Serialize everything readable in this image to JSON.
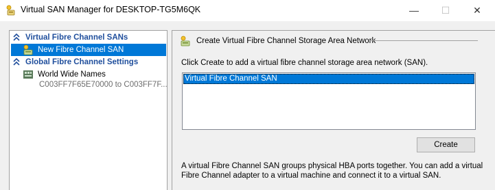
{
  "window": {
    "title": "Virtual SAN Manager for DESKTOP-TG5M6QK",
    "minimize_glyph": "—",
    "maximize_glyph": "☐",
    "close_glyph": "✕"
  },
  "sidebar": {
    "groups": [
      {
        "label": "Virtual Fibre Channel SANs",
        "icon": "chevron-up-icon",
        "items": [
          {
            "label": "New Fibre Channel SAN",
            "icon": "new-san-icon",
            "selected": true
          }
        ]
      },
      {
        "label": "Global Fibre Channel Settings",
        "icon": "chevron-up-icon",
        "items": [
          {
            "label": "World Wide Names",
            "icon": "wwn-icon",
            "selected": false,
            "sublabel": "C003FF7F65E70000 to C003FF7F..."
          }
        ]
      }
    ]
  },
  "main": {
    "header": "Create Virtual Fibre Channel Storage Area Network",
    "header_icon": "san-create-icon",
    "instruction": "Click Create to add a virtual fibre channel storage area network (SAN).",
    "list_items": [
      "Virtual Fibre Channel SAN"
    ],
    "create_label": "Create",
    "description": "A virtual Fibre Channel SAN groups physical HBA ports together. You can add a virtual Fibre Channel adapter to a virtual machine and connect it to a virtual SAN."
  },
  "colors": {
    "accent": "#0078d7",
    "group_header": "#1f4e9c",
    "panel_bg": "#f0f0f0"
  }
}
